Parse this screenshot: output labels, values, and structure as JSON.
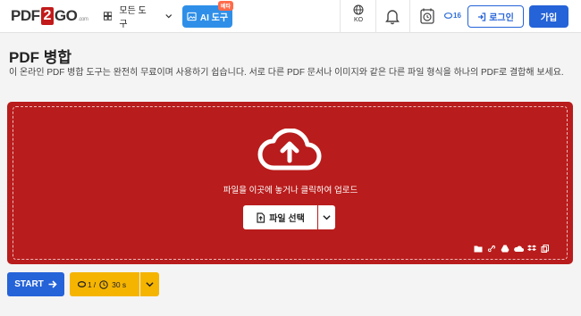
{
  "header": {
    "logo": {
      "pdf": "PDF",
      "two": "2",
      "go": "GO",
      "suffix": ".com"
    },
    "tools_label": "모든 도구",
    "ai_label": "AI 도구",
    "ai_badge": "베타",
    "language": "KO",
    "credits": "16",
    "login_label": "로그인",
    "signup_label": "가입"
  },
  "main": {
    "title": "PDF 병합",
    "description": "이 온라인 PDF 병합 도구는 완전히 무료이며 사용하기 쉽습니다. 서로 다른 PDF 문서나 이미지와 같은 다른 파일 형식을 하나의 PDF로 결합해 보세요."
  },
  "upload": {
    "drop_text": "파일을 이곳에 놓거나 클릭하여 업로드",
    "choose_label": "파일 선택",
    "sources": [
      "folder-icon",
      "link-icon",
      "google-drive-icon",
      "onedrive-icon",
      "dropbox-icon",
      "clipboard-icon"
    ]
  },
  "actions": {
    "start_label": "START",
    "limit_files": "1",
    "limit_time": "30 s",
    "limit_sep": "/"
  },
  "colors": {
    "brand_red": "#b91c1c",
    "primary_blue": "#2563d8",
    "ai_blue": "#2f8fe8",
    "limit_yellow": "#f5b400"
  }
}
